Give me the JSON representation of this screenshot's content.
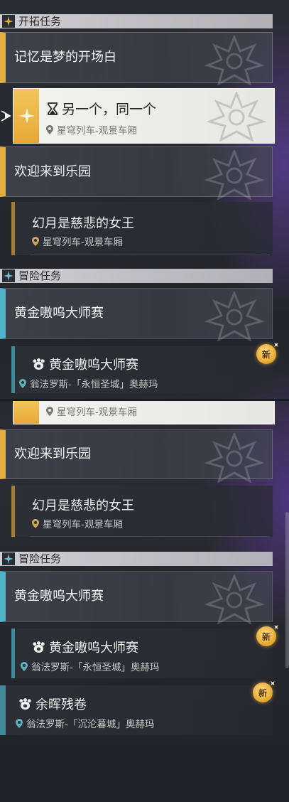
{
  "upper": {
    "section_trailblaze": "开拓任务",
    "quest1": "记忆是梦的开场白",
    "active_quest": {
      "title": "另一个，同一个",
      "location": "星穹列车-观景车厢"
    },
    "quest2": "欢迎来到乐园",
    "sub_quest2": {
      "title": "幻月是慈悲的女王",
      "location": "星穹列车-观景车厢"
    },
    "section_adventure": "冒险任务",
    "quest3": "黄金嗷呜大师赛",
    "sub_quest3": {
      "title": "黄金嗷呜大师赛",
      "location": "翁法罗斯-「永恒圣城」奥赫玛"
    },
    "new_badge": "新"
  },
  "lower": {
    "active_partial_location": "星穹列车-观景车厢",
    "quest2": "欢迎来到乐园",
    "sub_quest2": {
      "title": "幻月是慈悲的女王",
      "location": "星穹列车-观景车厢"
    },
    "section_adventure": "冒险任务",
    "quest3": "黄金嗷呜大师赛",
    "sub_quest3": {
      "title": "黄金嗷呜大师赛",
      "location": "翁法罗斯-「永恒圣城」奥赫玛"
    },
    "sub_quest4": {
      "title": "余晖残卷",
      "location": "翁法罗斯-「沉沦暮城」奥赫玛"
    },
    "new_badge": "新"
  },
  "colors": {
    "trailblaze_accent": "#e4ad3f",
    "adventure_accent": "#4fb3c7",
    "active_bg": "#f2f2f0"
  }
}
